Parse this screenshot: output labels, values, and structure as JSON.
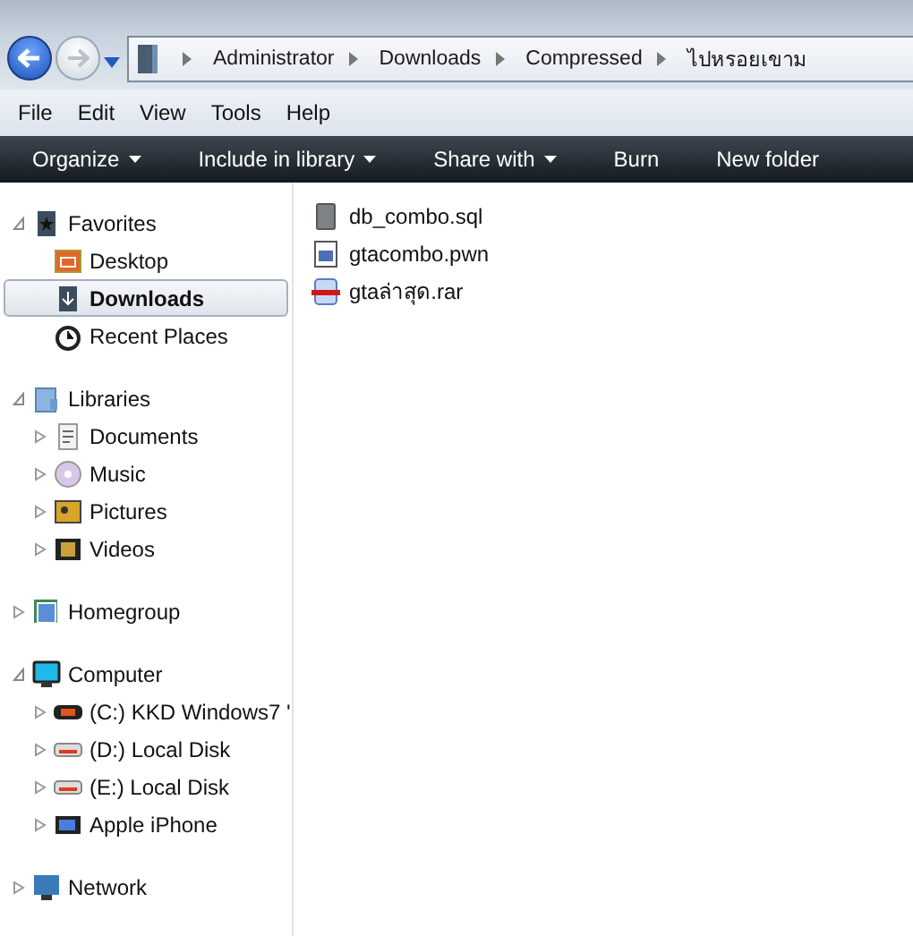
{
  "breadcrumb": [
    "Administrator",
    "Downloads",
    "Compressed",
    "ไปหรอยเขาม"
  ],
  "menu": [
    "File",
    "Edit",
    "View",
    "Tools",
    "Help"
  ],
  "toolbar": [
    {
      "label": "Organize",
      "dropdown": true
    },
    {
      "label": "Include in library",
      "dropdown": true
    },
    {
      "label": "Share with",
      "dropdown": true
    },
    {
      "label": "Burn",
      "dropdown": false
    },
    {
      "label": "New folder",
      "dropdown": false
    }
  ],
  "sidebar": [
    {
      "label": "Favorites",
      "expanded": true,
      "children": [
        {
          "label": "Desktop",
          "kind": "leaf",
          "selected": false
        },
        {
          "label": "Downloads",
          "kind": "leaf",
          "selected": true
        },
        {
          "label": "Recent Places",
          "kind": "leaf",
          "selected": false
        }
      ]
    },
    {
      "label": "Libraries",
      "expanded": true,
      "children": [
        {
          "label": "Documents",
          "kind": "node",
          "selected": false
        },
        {
          "label": "Music",
          "kind": "node",
          "selected": false
        },
        {
          "label": "Pictures",
          "kind": "node",
          "selected": false
        },
        {
          "label": "Videos",
          "kind": "node",
          "selected": false
        }
      ]
    },
    {
      "label": "Homegroup",
      "expanded": false
    },
    {
      "label": "Computer",
      "expanded": true,
      "children": [
        {
          "label": "(C:) KKD Windows7 '",
          "kind": "node",
          "selected": false
        },
        {
          "label": "(D:) Local Disk",
          "kind": "node",
          "selected": false
        },
        {
          "label": "(E:) Local Disk",
          "kind": "node",
          "selected": false
        },
        {
          "label": "Apple iPhone",
          "kind": "node",
          "selected": false
        }
      ]
    },
    {
      "label": "Network",
      "expanded": false
    }
  ],
  "files": [
    "db_combo.sql",
    "gtacombo.pwn",
    "gtaล่าสุด.rar"
  ]
}
